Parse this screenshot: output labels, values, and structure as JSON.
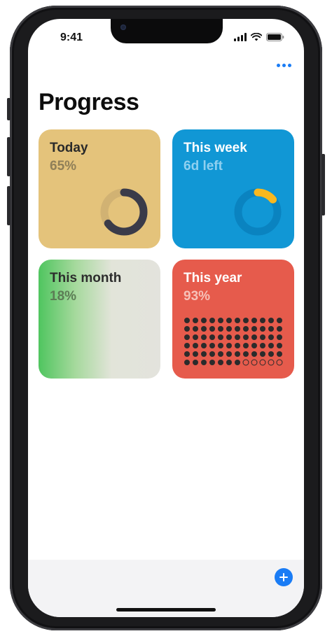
{
  "status_bar": {
    "time": "9:41",
    "icons": [
      "signal-icon",
      "wifi-icon",
      "battery-icon"
    ]
  },
  "header": {
    "more_icon": "more-icon",
    "title": "Progress"
  },
  "cards": [
    {
      "title": "Today",
      "value": "65%",
      "fraction": 0.65,
      "color": "#e4c37b",
      "visual": "donut-ring"
    },
    {
      "title": "This week",
      "value": "6d left",
      "fraction": 0.14,
      "color": "#1197d5",
      "visual": "donut-ring"
    },
    {
      "title": "This month",
      "value": "18%",
      "fraction": 0.18,
      "color": "#4fc55f",
      "visual": "gradient-fill"
    },
    {
      "title": "This year",
      "value": "93%",
      "fraction": 0.93,
      "color": "#e65b4c",
      "visual": "dot-grid"
    }
  ],
  "bottom_bar": {
    "add_icon": "plus-circle-icon"
  },
  "colors": {
    "accent": "#1a7cf5"
  }
}
